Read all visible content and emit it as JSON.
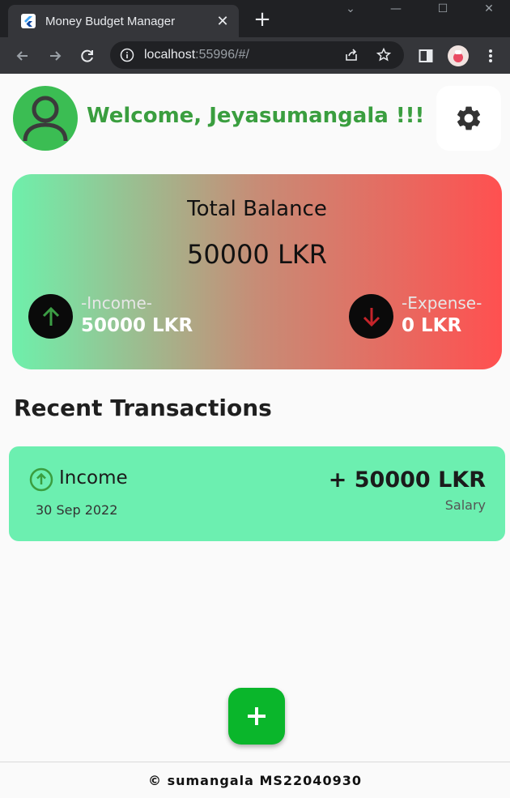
{
  "browser": {
    "tab_title": "Money Budget Manager",
    "tab_close": "✕",
    "new_tab": "+",
    "url_host": "localhost",
    "url_rest": ":55996/#/"
  },
  "header": {
    "welcome": "Welcome, Jeyasumangala !!!"
  },
  "balance": {
    "title": "Total Balance",
    "amount": "50000 LKR",
    "income_label": "-Income-",
    "income_value": "50000 LKR",
    "expense_label": "-Expense-",
    "expense_value": "0 LKR"
  },
  "recent": {
    "title": "Recent Transactions",
    "transactions": [
      {
        "type": "Income",
        "date": "30 Sep 2022",
        "amount": "+ 50000 LKR",
        "note": "Salary"
      }
    ]
  },
  "fab": {
    "icon": "plus-icon"
  },
  "footer": {
    "text": "© sumangala MS22040930"
  },
  "colors": {
    "accent_green": "#3a9e3f",
    "income_card": "#6cefb0",
    "fab": "#0ab62b",
    "expense_red": "#ff5050"
  }
}
